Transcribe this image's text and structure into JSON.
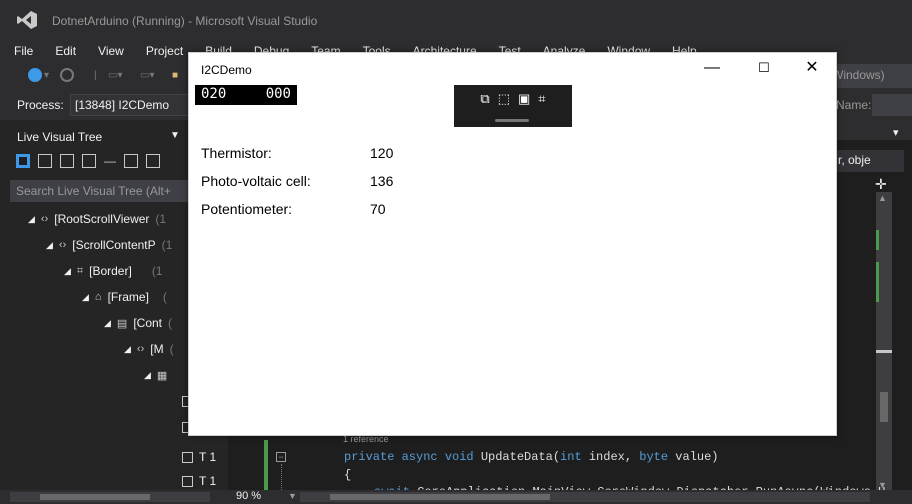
{
  "vs": {
    "title": "DotnetArduino (Running) - Microsoft Visual Studio",
    "menu": [
      "File",
      "Edit",
      "View",
      "Project",
      "Build",
      "Debug",
      "Team",
      "Tools",
      "Architecture",
      "Test",
      "Analyze",
      "Window",
      "Help"
    ],
    "search_fragment": "Windows)",
    "process_label": "Process:",
    "process_value": "[13848] I2CDemo",
    "name_label": "Name:"
  },
  "live_visual_tree": {
    "header": "Live Visual Tree",
    "search_placeholder": "Search Live Visual Tree (Alt+",
    "rows": [
      {
        "label": "[RootScrollViewer",
        "suffix": "(1"
      },
      {
        "label": "[ScrollContentP",
        "suffix": "(1"
      },
      {
        "label": "[Border]",
        "suffix": "(1"
      },
      {
        "label": "[Frame]",
        "suffix": "("
      },
      {
        "label": "[Cont",
        "suffix": "("
      },
      {
        "label": "[M",
        "suffix": "("
      },
      {
        "label": "",
        "suffix": ""
      }
    ],
    "bottom_rows": [
      "T 1",
      "T 1"
    ]
  },
  "right_panel": {
    "combo_text": "r, obje"
  },
  "code": {
    "reference": "1 reference",
    "line1_kw": "private async void",
    "line1_name": "UpdateData(",
    "line1_t1": "int",
    "line1_p1": "index,",
    "line1_t2": "byte",
    "line1_p2": "value)",
    "line2": "{",
    "line3_kw": "await",
    "line3_rest": "CoreApplication.MainView.CoreWindow.Dispatcher.RunAsync(Windows.U"
  },
  "status": {
    "zoom": "90 %"
  },
  "app": {
    "title": "I2CDemo",
    "fps_left": "020",
    "fps_right": "000",
    "readings": [
      {
        "label": "Thermistor:",
        "value": "120"
      },
      {
        "label": "Photo-voltaic cell:",
        "value": "136"
      },
      {
        "label": "Potentiometer:",
        "value": "70"
      }
    ]
  },
  "colors": {
    "vs_dark": "#2d2d30",
    "editor_bg": "#1e1e1e",
    "accent_blue": "#3e9ae8",
    "app_bg": "#ffffff"
  },
  "icons": [
    "vs-logo-icon",
    "back-icon",
    "forward-icon",
    "minimize-icon",
    "maximize-icon",
    "close-icon",
    "select-element-icon",
    "display-layout-adorners-icon",
    "track-focus-icon",
    "pin-icon"
  ]
}
